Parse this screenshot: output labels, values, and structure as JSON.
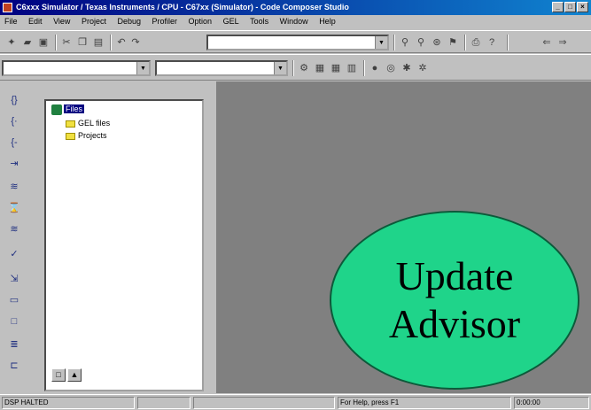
{
  "window": {
    "title": "C6xxx Simulator / Texas Instruments / CPU - C67xx (Simulator) - Code Composer Studio",
    "buttons": [
      "_",
      "□",
      "×"
    ]
  },
  "menu": [
    "File",
    "Edit",
    "View",
    "Project",
    "Debug",
    "Profiler",
    "Option",
    "GEL",
    "Tools",
    "Window",
    "Help"
  ],
  "toolbar1": {
    "combo_value": ""
  },
  "toolbar2": {
    "combo1_value": "",
    "combo2_value": ""
  },
  "file_tree": {
    "root": "Files",
    "children": [
      "GEL files",
      "Projects"
    ]
  },
  "pane_tabs": [
    "□",
    "▲"
  ],
  "advisor": {
    "line1": "Update",
    "line2": "Advisor",
    "color": "#1fd48a"
  },
  "status": {
    "cpu_state": "DSP HALTED",
    "position": "For Help, press F1",
    "clock": "0:00:00"
  },
  "colors": {
    "title_bar": "#000080",
    "workspace": "#808080",
    "selection": "#000080"
  }
}
